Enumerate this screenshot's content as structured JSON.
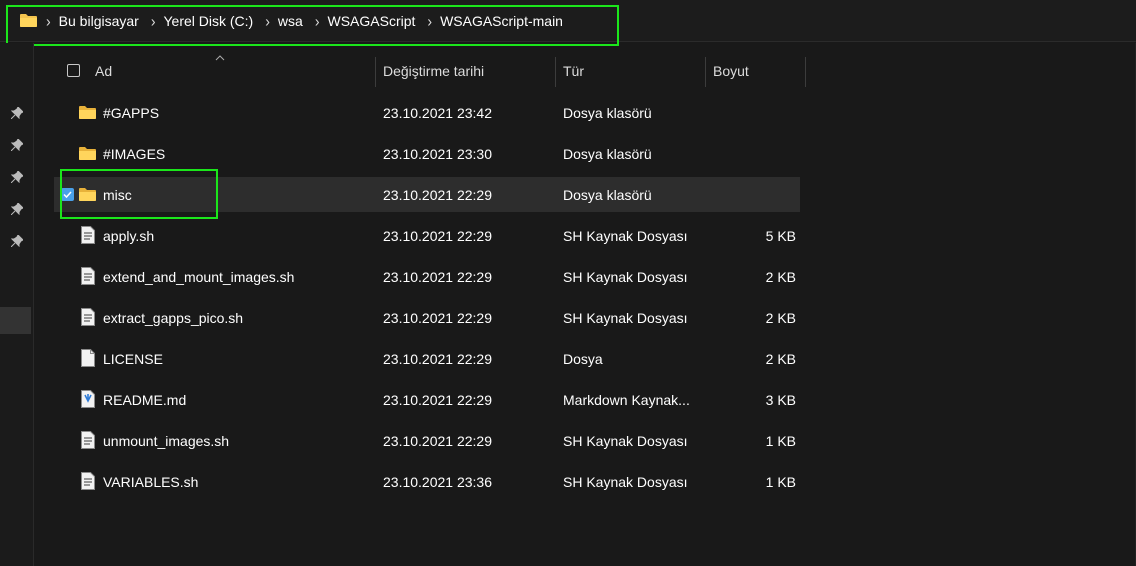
{
  "breadcrumb": [
    "Bu bilgisayar",
    "Yerel Disk (C:)",
    "wsa",
    "WSAGAScript",
    "WSAGAScript-main"
  ],
  "columns": {
    "name": "Ad",
    "date": "Değiştirme tarihi",
    "type": "Tür",
    "size": "Boyut"
  },
  "files": [
    {
      "name": "#GAPPS",
      "date": "23.10.2021 23:42",
      "type": "Dosya klasörü",
      "size": "",
      "icon": "folder-icon",
      "selected": false
    },
    {
      "name": "#IMAGES",
      "date": "23.10.2021 23:30",
      "type": "Dosya klasörü",
      "size": "",
      "icon": "folder-icon",
      "selected": false
    },
    {
      "name": "misc",
      "date": "23.10.2021 22:29",
      "type": "Dosya klasörü",
      "size": "",
      "icon": "folder-icon",
      "selected": true
    },
    {
      "name": "apply.sh",
      "date": "23.10.2021 22:29",
      "type": "SH Kaynak Dosyası",
      "size": "5 KB",
      "icon": "script-file-icon",
      "selected": false
    },
    {
      "name": "extend_and_mount_images.sh",
      "date": "23.10.2021 22:29",
      "type": "SH Kaynak Dosyası",
      "size": "2 KB",
      "icon": "script-file-icon",
      "selected": false
    },
    {
      "name": "extract_gapps_pico.sh",
      "date": "23.10.2021 22:29",
      "type": "SH Kaynak Dosyası",
      "size": "2 KB",
      "icon": "script-file-icon",
      "selected": false
    },
    {
      "name": "LICENSE",
      "date": "23.10.2021 22:29",
      "type": "Dosya",
      "size": "2 KB",
      "icon": "blank-file-icon",
      "selected": false
    },
    {
      "name": "README.md",
      "date": "23.10.2021 22:29",
      "type": "Markdown Kaynak...",
      "size": "3 KB",
      "icon": "markdown-file-icon",
      "selected": false
    },
    {
      "name": "unmount_images.sh",
      "date": "23.10.2021 22:29",
      "type": "SH Kaynak Dosyası",
      "size": "1 KB",
      "icon": "script-file-icon",
      "selected": false
    },
    {
      "name": "VARIABLES.sh",
      "date": "23.10.2021 23:36",
      "type": "SH Kaynak Dosyası",
      "size": "1 KB",
      "icon": "script-file-icon",
      "selected": false
    }
  ],
  "colors": {
    "background": "#191919",
    "selected_row": "#2d2d2d",
    "highlight": "#1be61b",
    "folder": "#f4c44e",
    "accent": "#4aa0e8"
  }
}
